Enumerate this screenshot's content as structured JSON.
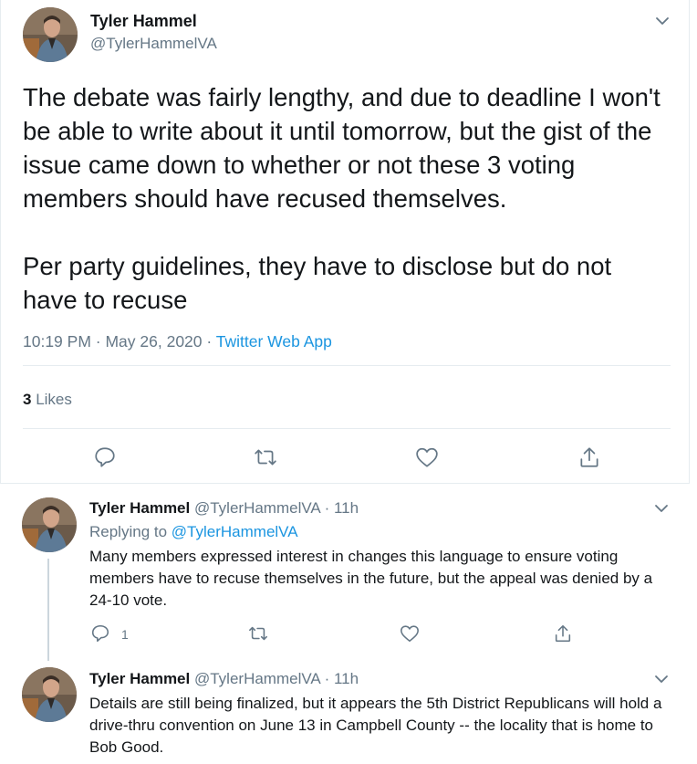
{
  "main_tweet": {
    "author_name": "Tyler Hammel",
    "author_handle": "@TylerHammelVA",
    "body": "The debate was fairly lengthy, and due to deadline I won't be able to write about it until tomorrow, but the gist of the issue came down to whether or not these 3 voting members should have recused themselves.\n\nPer party guidelines, they have to disclose but do not have to recuse",
    "time": "10:19 PM",
    "date": "May 26, 2020",
    "separator": "·",
    "app": "Twitter Web App",
    "likes_count": "3",
    "likes_label": "Likes"
  },
  "replies": [
    {
      "author_name": "Tyler Hammel",
      "author_handle": "@TylerHammelVA",
      "time_ago": "· 11h",
      "replying_to_label": "Replying to",
      "replying_to_handle": "@TylerHammelVA",
      "body": "Many members expressed interest in changes this language to ensure voting members have to recuse themselves in the future, but the appeal was denied by a 24-10 vote.",
      "reply_count": "1"
    },
    {
      "author_name": "Tyler Hammel",
      "author_handle": "@TylerHammelVA",
      "time_ago": "· 11h",
      "body": "Details are still being finalized, but it appears the 5th District Republicans will hold a drive-thru convention on June 13 in Campbell County -- the locality that is home to Bob Good."
    }
  ],
  "icons": [
    "chevron-down-icon",
    "reply-icon",
    "retweet-icon",
    "like-icon",
    "share-icon"
  ],
  "colors": {
    "link": "#1b95e0",
    "muted": "#657786",
    "text": "#14171a",
    "border": "#e6ecf0"
  }
}
